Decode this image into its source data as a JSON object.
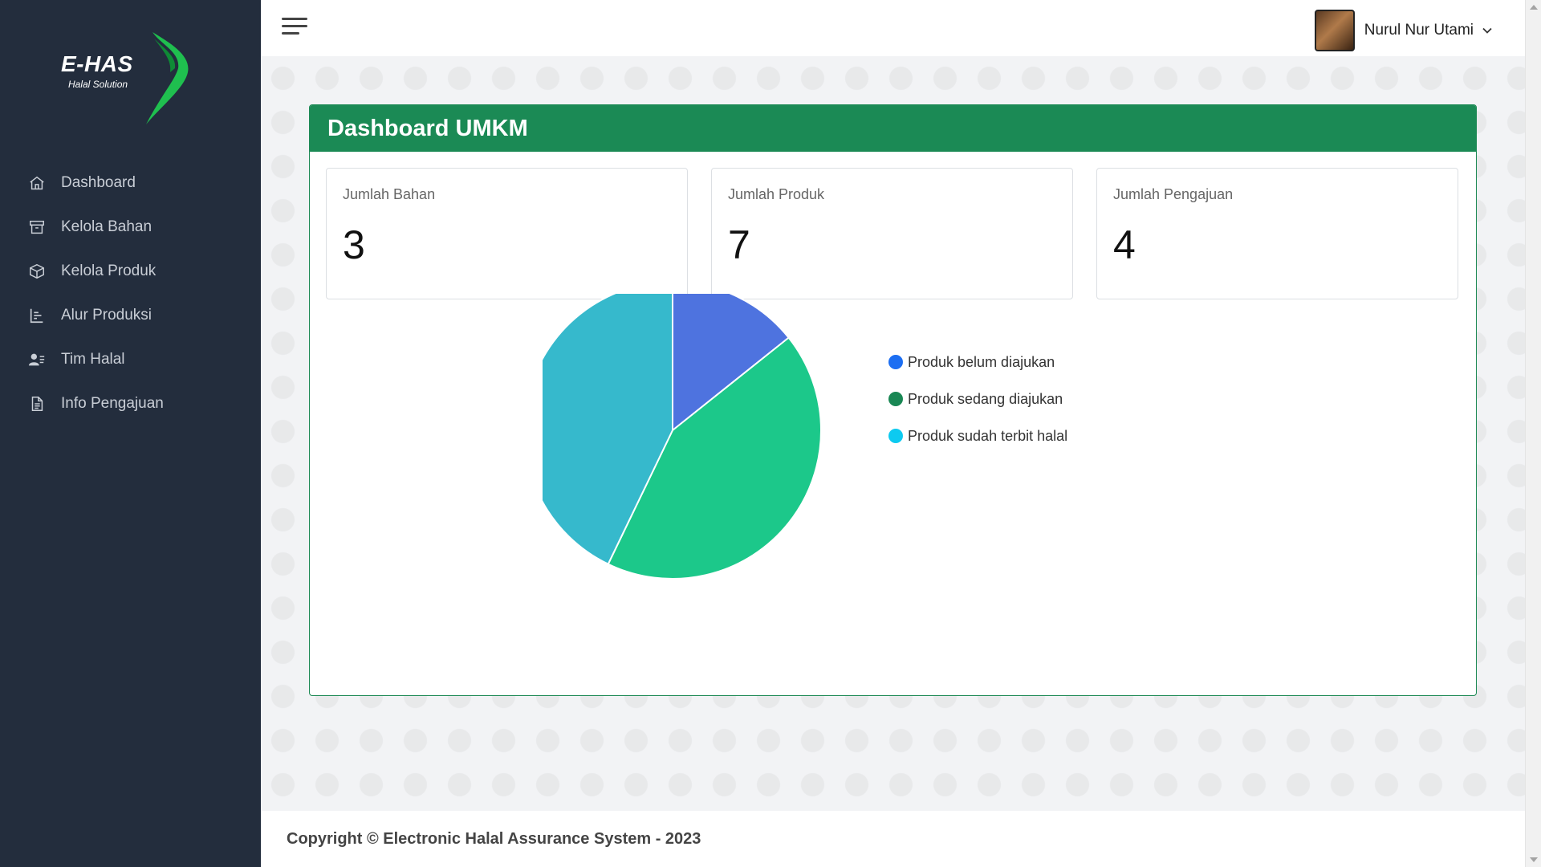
{
  "brand": {
    "name": "E-HAS",
    "tagline": "Halal Solution",
    "color": "#1b8a55"
  },
  "sidebar": {
    "items": [
      {
        "label": "Dashboard",
        "icon": "home-icon"
      },
      {
        "label": "Kelola Bahan",
        "icon": "archive-icon"
      },
      {
        "label": "Kelola Produk",
        "icon": "box-icon"
      },
      {
        "label": "Alur Produksi",
        "icon": "flow-list-icon"
      },
      {
        "label": "Tim Halal",
        "icon": "team-icon"
      },
      {
        "label": "Info Pengajuan",
        "icon": "document-icon"
      }
    ]
  },
  "topbar": {
    "user_name": "Nurul Nur Utami"
  },
  "card": {
    "title": "Dashboard UMKM",
    "stats": [
      {
        "label": "Jumlah Bahan",
        "value": "3"
      },
      {
        "label": "Jumlah Produk",
        "value": "7"
      },
      {
        "label": "Jumlah Pengajuan",
        "value": "4"
      }
    ]
  },
  "chart_data": {
    "type": "pie",
    "legend_position": "right",
    "slices": [
      {
        "label": "Produk belum diajukan",
        "value": 1,
        "color": "#4e73df",
        "legend_color": "#1c6ef2"
      },
      {
        "label": "Produk sedang diajukan",
        "value": 3,
        "color": "#1cc88a",
        "legend_color": "#198754"
      },
      {
        "label": "Produk sudah terbit halal",
        "value": 3,
        "color": "#36b9cc",
        "legend_color": "#0dcaf0"
      }
    ]
  },
  "footer": {
    "text": "Copyright © Electronic Halal Assurance System - 2023"
  }
}
